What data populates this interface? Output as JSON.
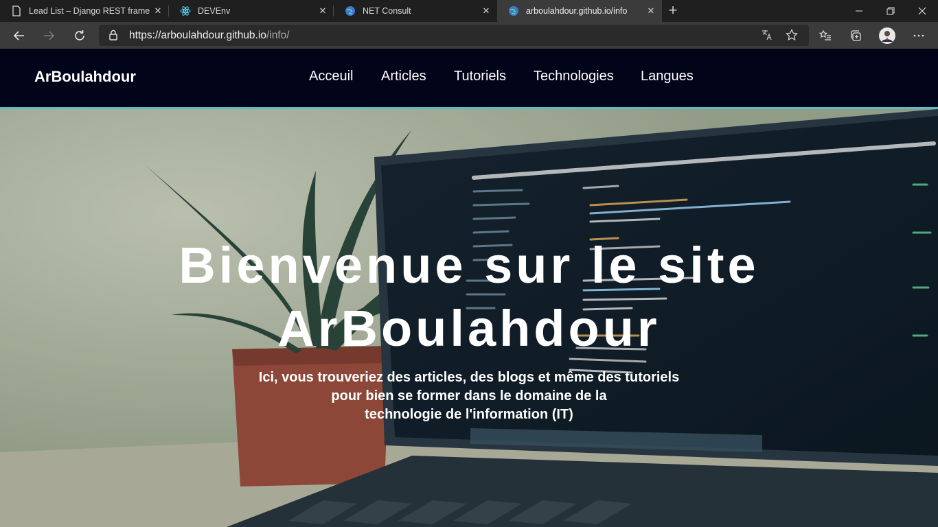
{
  "browser": {
    "tabs": [
      {
        "title": "Lead List – Django REST framewo",
        "icon": "document-icon"
      },
      {
        "title": "DEVEnv",
        "icon": "react-icon"
      },
      {
        "title": "NET Consult",
        "icon": "globe-icon"
      },
      {
        "title": "arboulahdour.github.io/info",
        "icon": "globe-icon",
        "active": true
      }
    ],
    "url_host": "https://arboulahdour.github.io",
    "url_path": "/info/"
  },
  "site": {
    "brand": "ArBoulahdour",
    "nav": [
      "Acceuil",
      "Articles",
      "Tutoriels",
      "Technologies",
      "Langues"
    ]
  },
  "hero": {
    "title_line1": "Bienvenue sur le site",
    "title_line2": "ArBoulahdour",
    "subtitle_line1": "Ici, vous trouveriez des articles, des blogs et même des tutoriels",
    "subtitle_line2": "pour bien se former dans le domaine de la",
    "subtitle_line3": "technologie de l'information (IT)"
  },
  "colors": {
    "header_bg": "#02041a",
    "header_border": "#5bbcc4",
    "tab_active": "#3b3b3b"
  }
}
